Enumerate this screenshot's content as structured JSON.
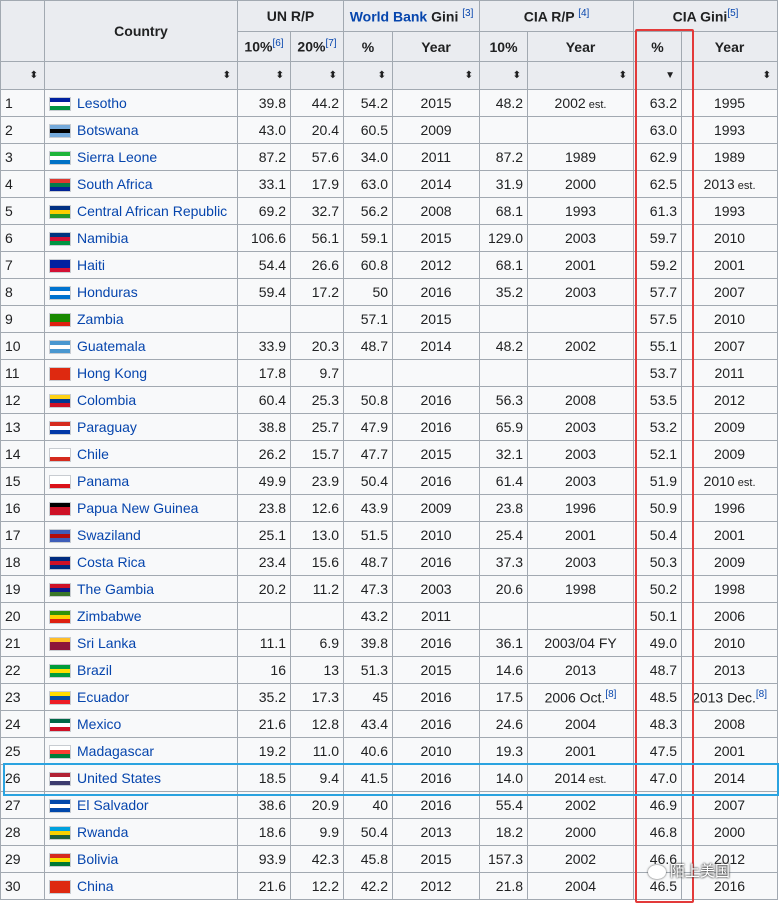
{
  "headers": {
    "country": "Country",
    "un_rp": "UN R/P",
    "un_10": "10%",
    "un_10_ref": "[6]",
    "un_20": "20%",
    "un_20_ref": "[7]",
    "wb_gini_link": "World Bank",
    "wb_gini_text": " Gini",
    "wb_gini_ref": "[3]",
    "wb_pct": "%",
    "wb_year": "Year",
    "cia_rp": "CIA R/P",
    "cia_rp_ref": "[4]",
    "cia_10": "10%",
    "cia_year": "Year",
    "cia_gini": "CIA Gini",
    "cia_gini_ref": "[5]",
    "cia_pct": "%",
    "cia_gini_year": "Year"
  },
  "colors": {
    "header_bg": "#eaecf0",
    "cell_bg": "#f8f9fa",
    "link": "#0645ad",
    "highlight_column": "#e33a3a",
    "highlight_row": "#2aa3e0"
  },
  "rows": [
    {
      "rank": "1",
      "country": "Lesotho",
      "flag": [
        "#00209f",
        "#ffffff",
        "#009543"
      ],
      "un10": "39.8",
      "un20": "44.2",
      "wbpct": "54.2",
      "wbyear": "2015",
      "cia10": "48.2",
      "ciayear": "2002",
      "ciayear_est": " est.",
      "ciapct": "63.2",
      "ciagyear": "1995",
      "ciagyear_est": ""
    },
    {
      "rank": "2",
      "country": "Botswana",
      "flag": [
        "#75aadb",
        "#000000",
        "#75aadb"
      ],
      "un10": "43.0",
      "un20": "20.4",
      "wbpct": "60.5",
      "wbyear": "2009",
      "cia10": "",
      "ciayear": "",
      "ciayear_est": "",
      "ciapct": "63.0",
      "ciagyear": "1993",
      "ciagyear_est": ""
    },
    {
      "rank": "3",
      "country": "Sierra Leone",
      "flag": [
        "#1eb53a",
        "#ffffff",
        "#0072c6"
      ],
      "un10": "87.2",
      "un20": "57.6",
      "wbpct": "34.0",
      "wbyear": "2011",
      "cia10": "87.2",
      "ciayear": "1989",
      "ciayear_est": "",
      "ciapct": "62.9",
      "ciagyear": "1989",
      "ciagyear_est": ""
    },
    {
      "rank": "4",
      "country": "South Africa",
      "flag": [
        "#de3831",
        "#007a4d",
        "#002395"
      ],
      "un10": "33.1",
      "un20": "17.9",
      "wbpct": "63.0",
      "wbyear": "2014",
      "cia10": "31.9",
      "ciayear": "2000",
      "ciayear_est": "",
      "ciapct": "62.5",
      "ciagyear": "2013",
      "ciagyear_est": " est."
    },
    {
      "rank": "5",
      "country": "Central African Republic",
      "flag": [
        "#003082",
        "#ffce00",
        "#289728"
      ],
      "un10": "69.2",
      "un20": "32.7",
      "wbpct": "56.2",
      "wbyear": "2008",
      "cia10": "68.1",
      "ciayear": "1993",
      "ciayear_est": "",
      "ciapct": "61.3",
      "ciagyear": "1993",
      "ciagyear_est": ""
    },
    {
      "rank": "6",
      "country": "Namibia",
      "flag": [
        "#003580",
        "#d21034",
        "#009543"
      ],
      "un10": "106.6",
      "un20": "56.1",
      "wbpct": "59.1",
      "wbyear": "2015",
      "cia10": "129.0",
      "ciayear": "2003",
      "ciayear_est": "",
      "ciapct": "59.7",
      "ciagyear": "2010",
      "ciagyear_est": ""
    },
    {
      "rank": "7",
      "country": "Haiti",
      "flag": [
        "#00209f",
        "#00209f",
        "#d21034"
      ],
      "un10": "54.4",
      "un20": "26.6",
      "wbpct": "60.8",
      "wbyear": "2012",
      "cia10": "68.1",
      "ciayear": "2001",
      "ciayear_est": "",
      "ciapct": "59.2",
      "ciagyear": "2001",
      "ciagyear_est": ""
    },
    {
      "rank": "8",
      "country": "Honduras",
      "flag": [
        "#0073cf",
        "#ffffff",
        "#0073cf"
      ],
      "un10": "59.4",
      "un20": "17.2",
      "wbpct": "50",
      "wbyear": "2016",
      "cia10": "35.2",
      "ciayear": "2003",
      "ciayear_est": "",
      "ciapct": "57.7",
      "ciagyear": "2007",
      "ciagyear_est": ""
    },
    {
      "rank": "9",
      "country": "Zambia",
      "flag": [
        "#198a00",
        "#198a00",
        "#de2010"
      ],
      "un10": "",
      "un20": "",
      "wbpct": "57.1",
      "wbyear": "2015",
      "cia10": "",
      "ciayear": "",
      "ciayear_est": "",
      "ciapct": "57.5",
      "ciagyear": "2010",
      "ciagyear_est": ""
    },
    {
      "rank": "10",
      "country": "Guatemala",
      "flag": [
        "#4997d0",
        "#ffffff",
        "#4997d0"
      ],
      "un10": "33.9",
      "un20": "20.3",
      "wbpct": "48.7",
      "wbyear": "2014",
      "cia10": "48.2",
      "ciayear": "2002",
      "ciayear_est": "",
      "ciapct": "55.1",
      "ciagyear": "2007",
      "ciagyear_est": ""
    },
    {
      "rank": "11",
      "country": "Hong Kong",
      "flag": [
        "#de2910",
        "#de2910",
        "#de2910"
      ],
      "un10": "17.8",
      "un20": "9.7",
      "wbpct": "",
      "wbyear": "",
      "cia10": "",
      "ciayear": "",
      "ciayear_est": "",
      "ciapct": "53.7",
      "ciagyear": "2011",
      "ciagyear_est": ""
    },
    {
      "rank": "12",
      "country": "Colombia",
      "flag": [
        "#fcd116",
        "#003893",
        "#ce1126"
      ],
      "un10": "60.4",
      "un20": "25.3",
      "wbpct": "50.8",
      "wbyear": "2016",
      "cia10": "56.3",
      "ciayear": "2008",
      "ciayear_est": "",
      "ciapct": "53.5",
      "ciagyear": "2012",
      "ciagyear_est": ""
    },
    {
      "rank": "13",
      "country": "Paraguay",
      "flag": [
        "#d52b1e",
        "#ffffff",
        "#0038a8"
      ],
      "un10": "38.8",
      "un20": "25.7",
      "wbpct": "47.9",
      "wbyear": "2016",
      "cia10": "65.9",
      "ciayear": "2003",
      "ciayear_est": "",
      "ciapct": "53.2",
      "ciagyear": "2009",
      "ciagyear_est": ""
    },
    {
      "rank": "14",
      "country": "Chile",
      "flag": [
        "#ffffff",
        "#ffffff",
        "#d52b1e"
      ],
      "un10": "26.2",
      "un20": "15.7",
      "wbpct": "47.7",
      "wbyear": "2015",
      "cia10": "32.1",
      "ciayear": "2003",
      "ciayear_est": "",
      "ciapct": "52.1",
      "ciagyear": "2009",
      "ciagyear_est": ""
    },
    {
      "rank": "15",
      "country": "Panama",
      "flag": [
        "#ffffff",
        "#ffffff",
        "#da121a"
      ],
      "un10": "49.9",
      "un20": "23.9",
      "wbpct": "50.4",
      "wbyear": "2016",
      "cia10": "61.4",
      "ciayear": "2003",
      "ciayear_est": "",
      "ciapct": "51.9",
      "ciagyear": "2010",
      "ciagyear_est": " est."
    },
    {
      "rank": "16",
      "country": "Papua New Guinea",
      "flag": [
        "#000000",
        "#ce1126",
        "#ce1126"
      ],
      "un10": "23.8",
      "un20": "12.6",
      "wbpct": "43.9",
      "wbyear": "2009",
      "cia10": "23.8",
      "ciayear": "1996",
      "ciayear_est": "",
      "ciapct": "50.9",
      "ciagyear": "1996",
      "ciagyear_est": ""
    },
    {
      "rank": "17",
      "country": "Swaziland",
      "flag": [
        "#3e5eb9",
        "#b10c0c",
        "#3e5eb9"
      ],
      "un10": "25.1",
      "un20": "13.0",
      "wbpct": "51.5",
      "wbyear": "2010",
      "cia10": "25.4",
      "ciayear": "2001",
      "ciayear_est": "",
      "ciapct": "50.4",
      "ciagyear": "2001",
      "ciagyear_est": ""
    },
    {
      "rank": "18",
      "country": "Costa Rica",
      "flag": [
        "#002b7f",
        "#ce1126",
        "#002b7f"
      ],
      "un10": "23.4",
      "un20": "15.6",
      "wbpct": "48.7",
      "wbyear": "2016",
      "cia10": "37.3",
      "ciayear": "2003",
      "ciayear_est": "",
      "ciapct": "50.3",
      "ciagyear": "2009",
      "ciagyear_est": ""
    },
    {
      "rank": "19",
      "country": "The Gambia",
      "flag": [
        "#ce1126",
        "#0c1c8c",
        "#3a7728"
      ],
      "un10": "20.2",
      "un20": "11.2",
      "wbpct": "47.3",
      "wbyear": "2003",
      "cia10": "20.6",
      "ciayear": "1998",
      "ciayear_est": "",
      "ciapct": "50.2",
      "ciagyear": "1998",
      "ciagyear_est": ""
    },
    {
      "rank": "20",
      "country": "Zimbabwe",
      "flag": [
        "#319208",
        "#ffd200",
        "#de2010"
      ],
      "un10": "",
      "un20": "",
      "wbpct": "43.2",
      "wbyear": "2011",
      "cia10": "",
      "ciayear": "",
      "ciayear_est": "",
      "ciapct": "50.1",
      "ciagyear": "2006",
      "ciagyear_est": ""
    },
    {
      "rank": "21",
      "country": "Sri Lanka",
      "flag": [
        "#ffbe29",
        "#8d153a",
        "#8d153a"
      ],
      "un10": "11.1",
      "un20": "6.9",
      "wbpct": "39.8",
      "wbyear": "2016",
      "cia10": "36.1",
      "ciayear": "2003/04 FY",
      "ciayear_est": "",
      "ciapct": "49.0",
      "ciagyear": "2010",
      "ciagyear_est": ""
    },
    {
      "rank": "22",
      "country": "Brazil",
      "flag": [
        "#009c3b",
        "#ffdf00",
        "#009c3b"
      ],
      "un10": "16",
      "un20": "13",
      "wbpct": "51.3",
      "wbyear": "2015",
      "cia10": "14.6",
      "ciayear": "2013",
      "ciayear_est": "",
      "ciapct": "48.7",
      "ciagyear": "2013",
      "ciagyear_est": ""
    },
    {
      "rank": "23",
      "country": "Ecuador",
      "flag": [
        "#ffdd00",
        "#034ea2",
        "#ed1c24"
      ],
      "un10": "35.2",
      "un20": "17.3",
      "wbpct": "45",
      "wbyear": "2016",
      "cia10": "17.5",
      "ciayear": "2006 Oct.",
      "ciayear_est": "",
      "ciayear_ref": "[8]",
      "ciapct": "48.5",
      "ciagyear": "2013 Dec.",
      "ciagyear_est": "",
      "ciagyear_ref": "[8]"
    },
    {
      "rank": "24",
      "country": "Mexico",
      "flag": [
        "#006847",
        "#ffffff",
        "#ce1126"
      ],
      "un10": "21.6",
      "un20": "12.8",
      "wbpct": "43.4",
      "wbyear": "2016",
      "cia10": "24.6",
      "ciayear": "2004",
      "ciayear_est": "",
      "ciapct": "48.3",
      "ciagyear": "2008",
      "ciagyear_est": ""
    },
    {
      "rank": "25",
      "country": "Madagascar",
      "flag": [
        "#ffffff",
        "#fc3d32",
        "#007e3a"
      ],
      "un10": "19.2",
      "un20": "11.0",
      "wbpct": "40.6",
      "wbyear": "2010",
      "cia10": "19.3",
      "ciayear": "2001",
      "ciayear_est": "",
      "ciapct": "47.5",
      "ciagyear": "2001",
      "ciagyear_est": ""
    },
    {
      "rank": "26",
      "country": "United States",
      "flag": [
        "#b22234",
        "#ffffff",
        "#3c3b6e"
      ],
      "un10": "18.5",
      "un20": "9.4",
      "wbpct": "41.5",
      "wbyear": "2016",
      "cia10": "14.0",
      "ciayear": "2014",
      "ciayear_est": " est.",
      "ciapct": "47.0",
      "ciagyear": "2014",
      "ciagyear_est": ""
    },
    {
      "rank": "27",
      "country": "El Salvador",
      "flag": [
        "#0047ab",
        "#ffffff",
        "#0047ab"
      ],
      "un10": "38.6",
      "un20": "20.9",
      "wbpct": "40",
      "wbyear": "2016",
      "cia10": "55.4",
      "ciayear": "2002",
      "ciayear_est": "",
      "ciapct": "46.9",
      "ciagyear": "2007",
      "ciagyear_est": ""
    },
    {
      "rank": "28",
      "country": "Rwanda",
      "flag": [
        "#00a1de",
        "#fad201",
        "#20603d"
      ],
      "un10": "18.6",
      "un20": "9.9",
      "wbpct": "50.4",
      "wbyear": "2013",
      "cia10": "18.2",
      "ciayear": "2000",
      "ciayear_est": "",
      "ciapct": "46.8",
      "ciagyear": "2000",
      "ciagyear_est": ""
    },
    {
      "rank": "29",
      "country": "Bolivia",
      "flag": [
        "#d52b1e",
        "#f9e300",
        "#007934"
      ],
      "un10": "93.9",
      "un20": "42.3",
      "wbpct": "45.8",
      "wbyear": "2015",
      "cia10": "157.3",
      "ciayear": "2002",
      "ciayear_est": "",
      "ciapct": "46.6",
      "ciagyear": "2012",
      "ciagyear_est": ""
    },
    {
      "rank": "30",
      "country": "China",
      "flag": [
        "#de2910",
        "#de2910",
        "#de2910"
      ],
      "un10": "21.6",
      "un20": "12.2",
      "wbpct": "42.2",
      "wbyear": "2012",
      "cia10": "21.8",
      "ciayear": "2004",
      "ciayear_est": "",
      "ciapct": "46.5",
      "ciagyear": "2016",
      "ciagyear_est": ""
    }
  ],
  "sort_icons": {
    "unsorted": "⬍",
    "sorted_desc": "▼"
  },
  "watermark": {
    "text": "陌上美国"
  }
}
